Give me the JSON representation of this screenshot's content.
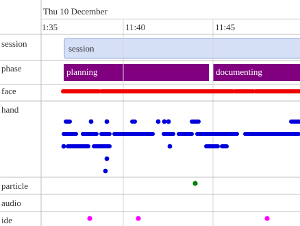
{
  "header": {
    "date_label": "Thu 10 December",
    "times": [
      "1:35",
      "11:40",
      "11:45"
    ]
  },
  "rows": [
    {
      "key": "session",
      "label": "session"
    },
    {
      "key": "phase",
      "label": "phase"
    },
    {
      "key": "face",
      "label": "face"
    },
    {
      "key": "hand",
      "label": "hand"
    },
    {
      "key": "particle",
      "label": "particle"
    },
    {
      "key": "audio",
      "label": "audio"
    },
    {
      "key": "ide",
      "label": "ide"
    }
  ],
  "session": {
    "label": "session",
    "color": "#d5dff5",
    "border": "#8fa6dc"
  },
  "phase": {
    "color": "#800080",
    "text_color": "#ffffff",
    "items": [
      {
        "label": "planning"
      },
      {
        "label": "documenting"
      }
    ]
  },
  "colors": {
    "face": "#ee0000",
    "hand": "#0000dd",
    "particle": "#008000",
    "ide": "#ff00ff",
    "grid": "#d6d6d6",
    "axis": "#bfbfbf",
    "text": "#333333"
  }
}
